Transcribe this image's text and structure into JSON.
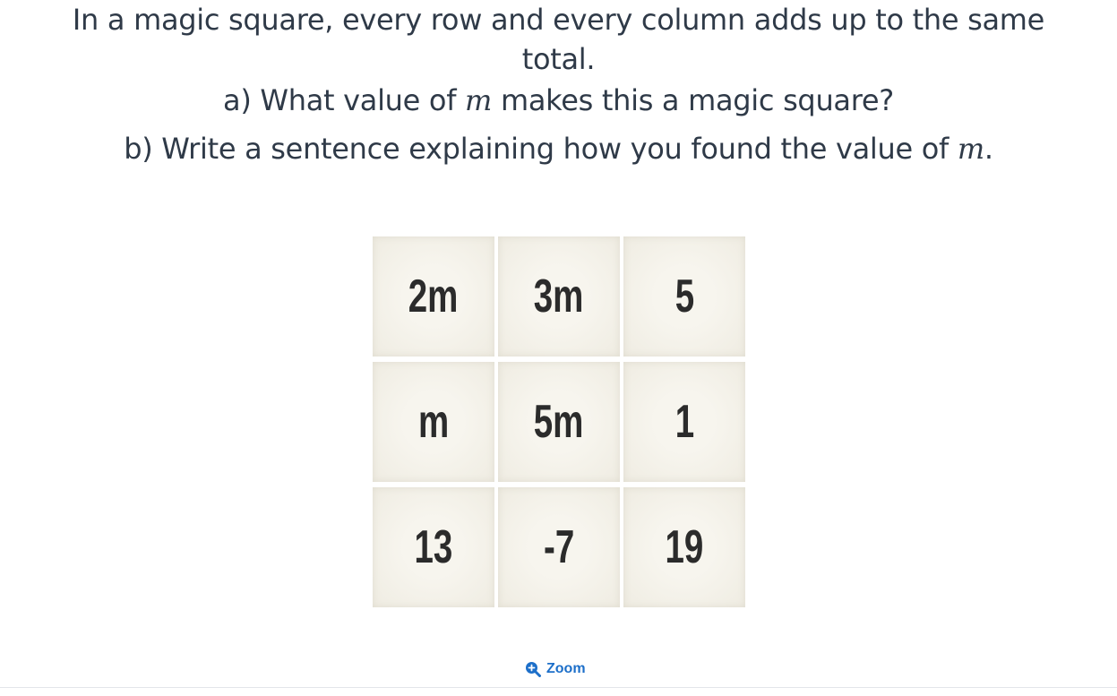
{
  "question": {
    "intro": "In a magic square, every row and every column adds up to the same total.",
    "part_a_before": "a) What value of ",
    "part_a_var": "m",
    "part_a_after": " makes this a magic square?",
    "part_b_before": "b) Write a sentence explaining how you found the value of ",
    "part_b_var": "m",
    "part_b_after": "."
  },
  "magic_square": {
    "rows": [
      [
        "2m",
        "3m",
        "5"
      ],
      [
        "m",
        "5m",
        "1"
      ],
      [
        "13",
        "-7",
        "19"
      ]
    ]
  },
  "zoom": {
    "label": "Zoom",
    "icon": "zoom-in-icon",
    "color": "#1d6fc9"
  }
}
